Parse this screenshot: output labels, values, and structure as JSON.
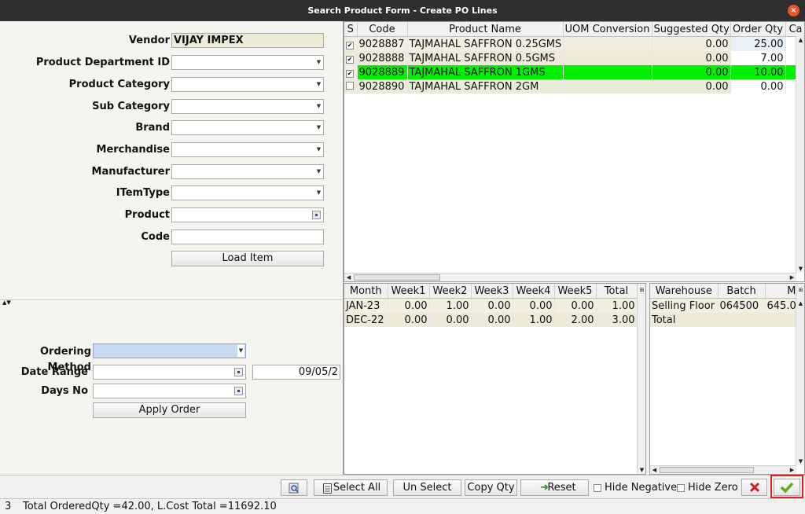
{
  "window": {
    "title": "Search Product Form - Create PO Lines",
    "close_glyph": "×"
  },
  "form": {
    "vendor_label": "Vendor",
    "vendor_value": "VIJAY IMPEX",
    "dept_label": "Product Department ID",
    "category_label": "Product Category",
    "subcategory_label": "Sub Category",
    "brand_label": "Brand",
    "merch_label": "Merchandise",
    "manufacturer_label": "Manufacturer",
    "itemtype_label": "ITemType",
    "product_label": "Product",
    "code_label": "Code",
    "load_button": "Load Item",
    "ordering_label": "Ordering Method",
    "daterange_label": "Date Range",
    "date_value": "09/05/2",
    "daysno_label": "Days No",
    "apply_button": "Apply Order"
  },
  "product_grid": {
    "columns": [
      "S",
      "Code",
      "Product Name",
      "UOM Conversion",
      "Suggested Qty",
      "Order Qty",
      "Ca"
    ],
    "rows": [
      {
        "checked": "✔",
        "code": "9028887",
        "name": "TAJMAHAL SAFFRON 0.25GMS",
        "uom": "",
        "suggested": "0.00",
        "order": "25.00"
      },
      {
        "checked": "✔",
        "code": "9028888",
        "name": "TAJMAHAL SAFFRON 0.5GMS",
        "uom": "",
        "suggested": "0.00",
        "order": "7.00"
      },
      {
        "checked": "✔",
        "code": "9028889",
        "name": "TAJMAHAL SAFFRON 1GMS",
        "uom": "",
        "suggested": "0.00",
        "order": "10.00"
      },
      {
        "checked": "",
        "code": "9028890",
        "name": "TAJMAHAL SAFFRON 2GM",
        "uom": "",
        "suggested": "0.00",
        "order": "0.00"
      }
    ]
  },
  "sales_grid": {
    "columns": [
      "Month",
      "Week1",
      "Week2",
      "Week3",
      "Week4",
      "Week5",
      "Total"
    ],
    "rows": [
      [
        "JAN-23",
        "0.00",
        "1.00",
        "0.00",
        "0.00",
        "0.00",
        "1.00"
      ],
      [
        "DEC-22",
        "0.00",
        "0.00",
        "0.00",
        "1.00",
        "2.00",
        "3.00"
      ]
    ]
  },
  "stock_grid": {
    "columns": [
      "Warehouse",
      "Batch",
      "MRF"
    ],
    "rows": [
      [
        "Selling Floor",
        "064500",
        "645.0"
      ],
      [
        "Total",
        "",
        ""
      ]
    ]
  },
  "toolbar": {
    "select_all": "Select All",
    "select_all_u": "A",
    "un_select": "Un Select",
    "copy_qty": "Copy Qty",
    "reset": "Reset",
    "hide_negative": "Hide Negative",
    "hide_zero": "Hide Zero"
  },
  "status": {
    "count": "3",
    "text": "Total OrderedQty =42.00, L.Cost Total =11692.10"
  },
  "colors": {
    "selected_row": "#00f000",
    "ok_highlight": "#e02020"
  }
}
